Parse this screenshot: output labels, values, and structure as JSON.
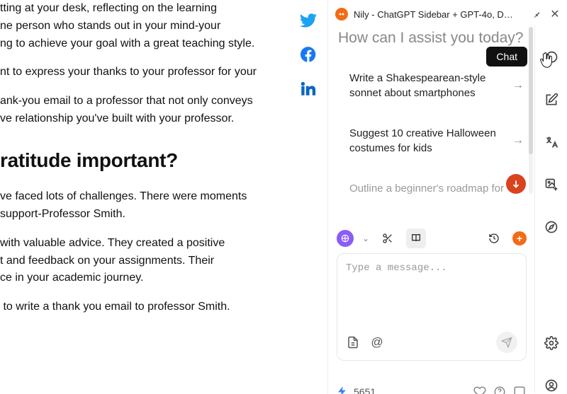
{
  "article": {
    "p1_l1": "tting at your desk, reflecting on the learning",
    "p1_l2": "ne person who stands out in your mind-your",
    "p1_l3": "ng to achieve your goal with a great teaching style.",
    "p2_l1": "nt to express your thanks to your professor for your",
    "p3_l1": "ank-you email to a professor that not only conveys",
    "p3_l2": "ve relationship you've built with your professor.",
    "heading": "ratitude important?",
    "p4_l1": "ve faced lots of challenges. There were moments",
    "p4_l2": "support-Professor Smith.",
    "p5_l1": "with valuable advice. They created a positive",
    "p5_l2": "t and feedback on your assignments. Their",
    "p5_l3": "ce in your academic journey.",
    "p6_l1": " to write a thank you email to professor Smith."
  },
  "panel": {
    "title": "Nily - ChatGPT Sidebar + GPT-4o, D…",
    "prompt_title": "How can I assist you today?",
    "tooltip": "Chat",
    "suggestions": [
      "Write a Shakespearean-style sonnet about smartphones",
      "Suggest 10 creative Halloween costumes for kids",
      "Outline a beginner's roadmap for"
    ],
    "composer_placeholder": "Type a message...",
    "token_count": "5651"
  },
  "icons": {
    "twitter": "twitter-icon",
    "facebook": "facebook-icon",
    "linkedin": "linkedin-icon"
  }
}
